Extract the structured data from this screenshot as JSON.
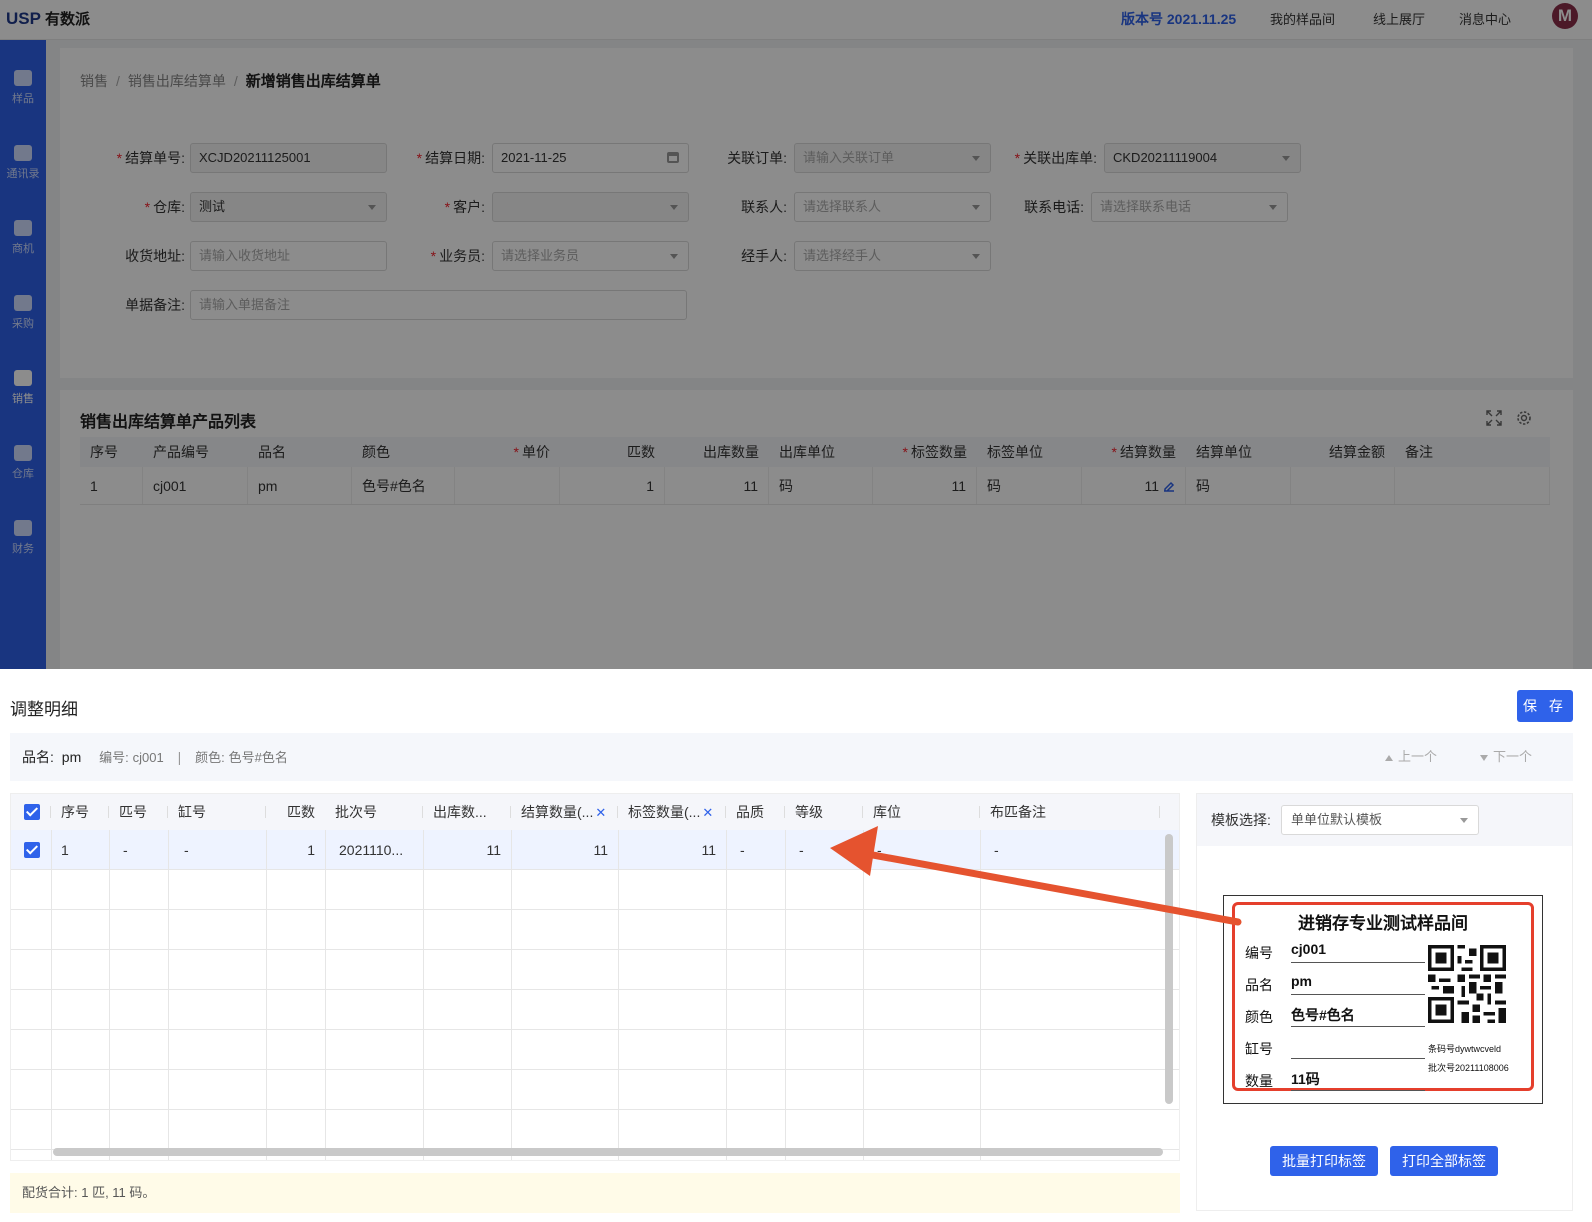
{
  "app": {
    "logo": "USP",
    "logo_cn": "有数派",
    "version": "版本号 2021.11.25",
    "top_nav": [
      "我的样品间",
      "线上展厅",
      "消息中心"
    ],
    "avatar_letter": "M"
  },
  "sidebar": {
    "items": [
      {
        "label": "样品",
        "icon": "box-icon"
      },
      {
        "label": "通讯录",
        "icon": "contacts-icon"
      },
      {
        "label": "商机",
        "icon": "bulb-icon"
      },
      {
        "label": "采购",
        "icon": "cart-icon"
      },
      {
        "label": "销售",
        "icon": "clipboard-check-icon"
      },
      {
        "label": "仓库",
        "icon": "warehouse-icon"
      },
      {
        "label": "财务",
        "icon": "money-bag-icon"
      }
    ],
    "active": "销售"
  },
  "breadcrumb": [
    "销售",
    "销售出库结算单",
    "新增销售出库结算单"
  ],
  "form": {
    "settle_no_label": "结算单号:",
    "settle_no": "XCJD20211125001",
    "settle_date_label": "结算日期:",
    "settle_date": "2021-11-25",
    "order_label": "关联订单:",
    "order_placeholder": "请输入关联订单",
    "outbound_label": "关联出库单:",
    "outbound": "CKD20211119004",
    "warehouse_label": "仓库:",
    "warehouse": "测试",
    "customer_label": "客户:",
    "customer": "",
    "contact_label": "联系人:",
    "contact_placeholder": "请选择联系人",
    "phone_label": "联系电话:",
    "phone_placeholder": "请选择联系电话",
    "address_label": "收货地址:",
    "address_placeholder": "请输入收货地址",
    "salesman_label": "业务员:",
    "salesman_placeholder": "请选择业务员",
    "handler_label": "经手人:",
    "handler_placeholder": "请选择经手人",
    "remark_label": "单据备注:",
    "remark_placeholder": "请输入单据备注"
  },
  "product_list": {
    "title": "销售出库结算单产品列表",
    "columns": [
      "序号",
      "产品编号",
      "品名",
      "颜色",
      "单价",
      "匹数",
      "出库数量",
      "出库单位",
      "标签数量",
      "标签单位",
      "结算数量",
      "结算单位",
      "结算金额",
      "备注"
    ],
    "rows": [
      [
        "1",
        "cj001",
        "pm",
        "色号#色名",
        "",
        "1",
        "11",
        "码",
        "11",
        "码",
        "11",
        "码",
        "",
        ""
      ]
    ]
  },
  "drawer": {
    "title": "调整明细",
    "save": "保 存",
    "info": {
      "name_label": "品名:",
      "name": "pm",
      "code_label": "编号:",
      "code": "cj001",
      "color_label": "颜色:",
      "color": "色号#色名",
      "prev": "上一个",
      "next": "下一个"
    },
    "table": {
      "columns": [
        "序号",
        "匹号",
        "缸号",
        "匹数",
        "批次号",
        "出库数...",
        "结算数量(...",
        "标签数量(...",
        "品质",
        "等级",
        "库位",
        "布匹备注"
      ],
      "rows": [
        [
          "1",
          "-",
          "-",
          "1",
          "2021110...",
          "11",
          "11",
          "11",
          "-",
          "-",
          "-",
          "-"
        ]
      ]
    },
    "summary": "配货合计: 1 匹, 11 码。",
    "template_label": "模板选择:",
    "template": "单单位默认模板",
    "label_preview": {
      "title": "进销存专业测试样品间",
      "fields": [
        {
          "key": "编号",
          "value": "cj001"
        },
        {
          "key": "品名",
          "value": "pm"
        },
        {
          "key": "颜色",
          "value": "色号#色名"
        },
        {
          "key": "缸号",
          "value": ""
        },
        {
          "key": "数量",
          "value": "11码"
        }
      ],
      "barcode": "条码号dywtwcveld",
      "batch": "批次号20211108006"
    },
    "batch_print": "批量打印标签",
    "print_all": "打印全部标签"
  },
  "colors": {
    "primary": "#2f62ea",
    "danger": "#e53f2c",
    "sidebar": "#2f62ea"
  }
}
